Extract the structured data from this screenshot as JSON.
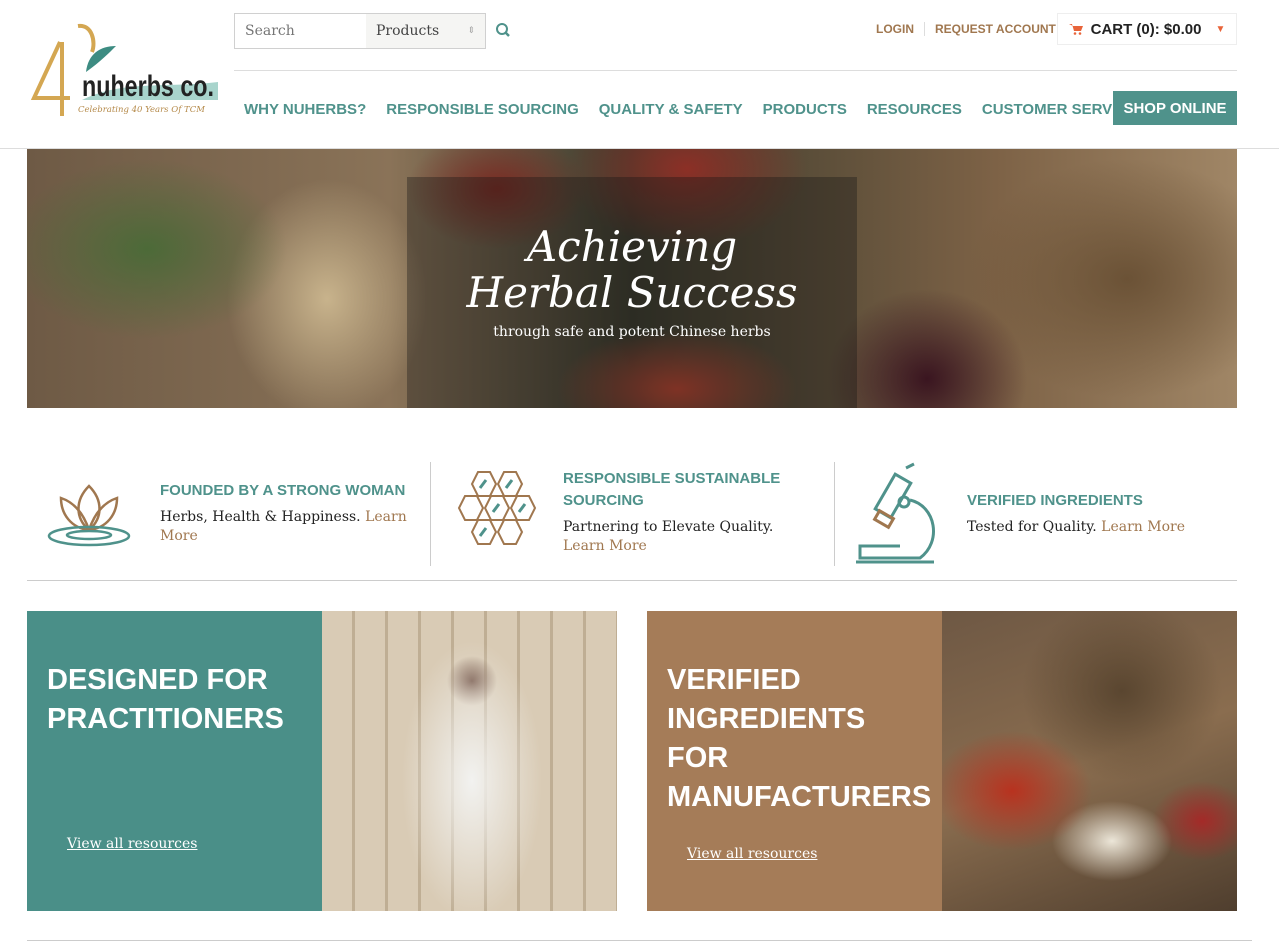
{
  "logo": {
    "text": "nuherbs co.",
    "number": "40",
    "tagline": "Celebrating 40 Years Of TCM"
  },
  "search": {
    "placeholder": "Search",
    "category": "Products"
  },
  "top_links": {
    "login": "LOGIN",
    "request": "REQUEST ACCOUNT",
    "cart": "CART (0): $0.00"
  },
  "nav": [
    "WHY NUHERBS?",
    "RESPONSIBLE SOURCING",
    "QUALITY & SAFETY",
    "PRODUCTS",
    "RESOURCES",
    "CUSTOMER SERVICE"
  ],
  "shop_online": "SHOP ONLINE",
  "hero": {
    "title": "Achieving Herbal Success",
    "subtitle": "through safe and potent Chinese herbs"
  },
  "features": [
    {
      "title": "FOUNDED BY A STRONG WOMAN",
      "text": "Herbs, Health & Happiness.",
      "link": "Learn More",
      "icon": "lotus-icon"
    },
    {
      "title": "RESPONSIBLE SUSTAINABLE SOURCING",
      "text": "Partnering to Elevate Quality.",
      "link": "Learn More",
      "icon": "hexagon-icon"
    },
    {
      "title": "VERIFIED INGREDIENTS",
      "text": "Tested for Quality.",
      "link": "Learn More",
      "icon": "microscope-icon"
    }
  ],
  "cards": [
    {
      "title": "DESIGNED FOR PRACTITIONERS",
      "link": "View all resources",
      "color": "#4a8f88"
    },
    {
      "title": "VERIFIED INGREDIENTS FOR MANUFACTURERS",
      "link": "View all resources",
      "color": "#a57c58"
    }
  ],
  "colors": {
    "teal": "#4f928b",
    "brown": "#a0774f",
    "cart_icon": "#e8643a"
  }
}
